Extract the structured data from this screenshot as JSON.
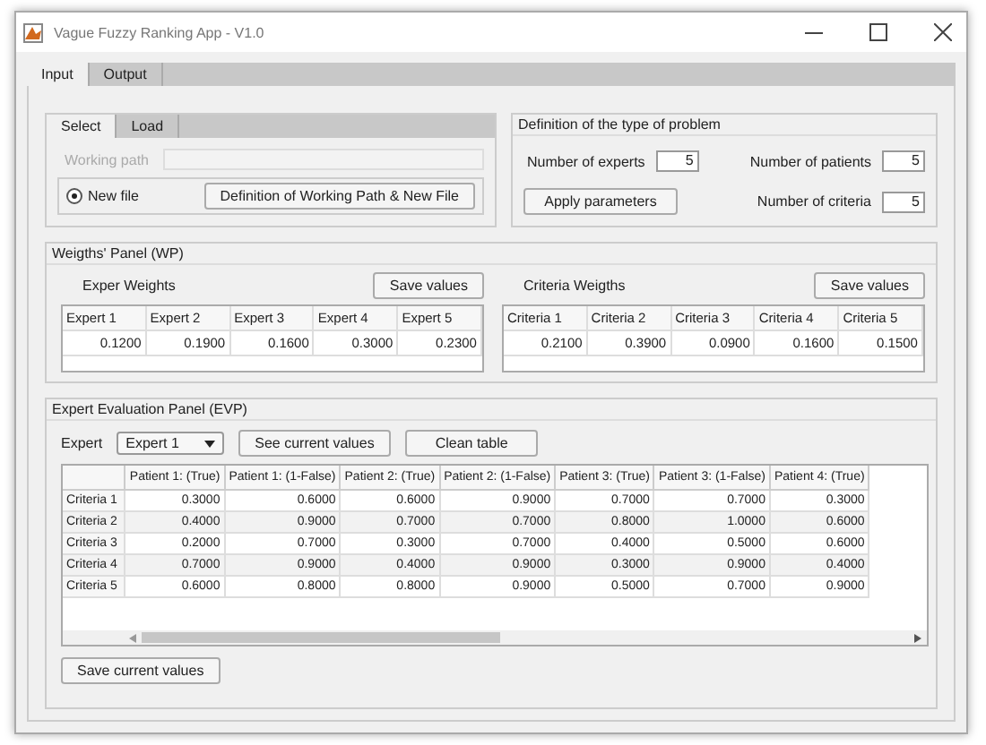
{
  "window": {
    "title": "Vague Fuzzy Ranking App - V1.0"
  },
  "tabs": [
    {
      "label": "Input",
      "selected": true
    },
    {
      "label": "Output",
      "selected": false
    }
  ],
  "select_panel": {
    "tabs": [
      {
        "label": "Select",
        "selected": true
      },
      {
        "label": "Load",
        "selected": false
      }
    ],
    "working_path": {
      "label": "Working path",
      "disabled": true
    },
    "new_file": {
      "label": "New file",
      "selected": true
    },
    "button": "Definition of Working Path & New File"
  },
  "problem_panel": {
    "title": "Definition of the type of problem",
    "fields": [
      {
        "label": "Number of experts",
        "value": "5"
      },
      {
        "label": "Number of patients",
        "value": "5"
      },
      {
        "label": "Number of criteria",
        "value": "5"
      }
    ],
    "apply_button": "Apply parameters"
  },
  "weights_panel": {
    "title": "Weigths' Panel (WP)",
    "groups": [
      {
        "label": "Exper Weights",
        "button": "Save values",
        "columns": [
          "Expert 1",
          "Expert 2",
          "Expert 3",
          "Expert 4",
          "Expert 5"
        ],
        "values": [
          "0.1200",
          "0.1900",
          "0.1600",
          "0.3000",
          "0.2300"
        ]
      },
      {
        "label": "Criteria Weigths",
        "button": "Save values",
        "columns": [
          "Criteria 1",
          "Criteria 2",
          "Criteria 3",
          "Criteria 4",
          "Criteria 5"
        ],
        "values": [
          "0.2100",
          "0.3900",
          "0.0900",
          "0.1600",
          "0.1500"
        ]
      }
    ]
  },
  "evaluation_panel": {
    "title": "Expert Evaluation Panel (EVP)",
    "expert_label": "Expert",
    "expert_dropdown": "Expert 1",
    "buttons": [
      "See current values",
      "Clean table"
    ],
    "table": {
      "columns": [
        "Patient 1: (True)",
        "Patient 1: (1-False)",
        "Patient 2: (True)",
        "Patient 2: (1-False)",
        "Patient 3: (True)",
        "Patient 3: (1-False)",
        "Patient 4: (True)"
      ],
      "rows": [
        {
          "header": "Criteria 1",
          "cells": [
            "0.3000",
            "0.6000",
            "0.6000",
            "0.9000",
            "0.7000",
            "0.7000",
            "0.3000"
          ]
        },
        {
          "header": "Criteria 2",
          "cells": [
            "0.4000",
            "0.9000",
            "0.7000",
            "0.7000",
            "0.8000",
            "1.0000",
            "0.6000"
          ]
        },
        {
          "header": "Criteria 3",
          "cells": [
            "0.2000",
            "0.7000",
            "0.3000",
            "0.7000",
            "0.4000",
            "0.5000",
            "0.6000"
          ]
        },
        {
          "header": "Criteria 4",
          "cells": [
            "0.7000",
            "0.9000",
            "0.4000",
            "0.9000",
            "0.3000",
            "0.9000",
            "0.4000"
          ]
        },
        {
          "header": "Criteria 5",
          "cells": [
            "0.6000",
            "0.8000",
            "0.8000",
            "0.9000",
            "0.5000",
            "0.7000",
            "0.9000"
          ]
        }
      ]
    },
    "save_button": "Save current values"
  }
}
